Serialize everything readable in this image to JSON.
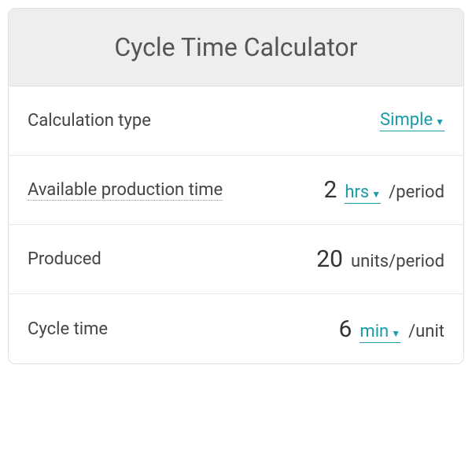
{
  "title": "Cycle Time Calculator",
  "rows": {
    "calculation_type": {
      "label": "Calculation type",
      "value": "Simple"
    },
    "available_production_time": {
      "label": "Available production time",
      "value": "2",
      "unit": "hrs",
      "suffix": "/period"
    },
    "produced": {
      "label": "Produced",
      "value": "20",
      "suffix": "units/period"
    },
    "cycle_time": {
      "label": "Cycle time",
      "value": "6",
      "unit": "min",
      "suffix": "/unit"
    }
  }
}
